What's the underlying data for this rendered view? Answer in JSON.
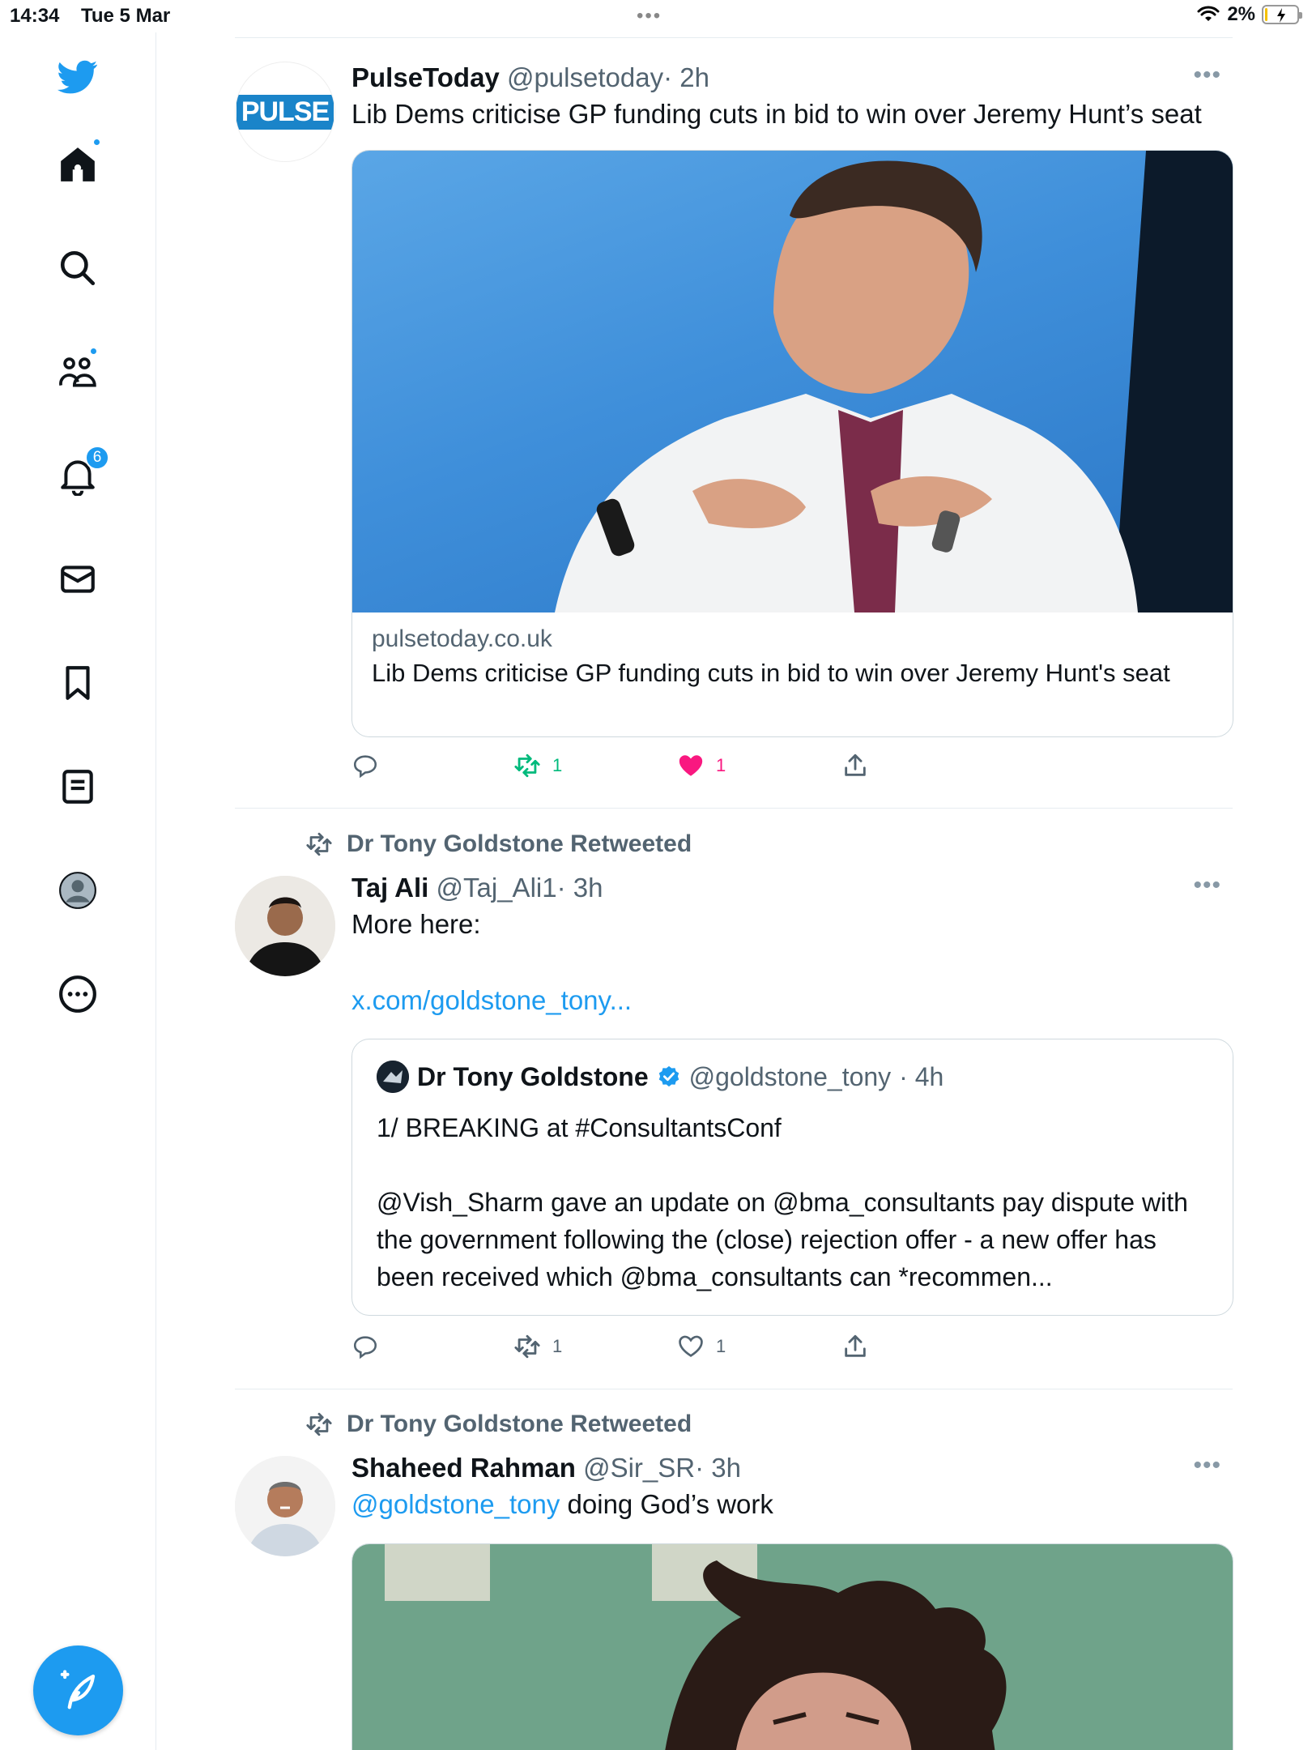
{
  "status_bar": {
    "time": "14:34",
    "date": "Tue 5 Mar",
    "battery": "2%",
    "battery_level": 0.02
  },
  "sidebar": {
    "items": [
      {
        "icon": "twitter-logo-icon"
      },
      {
        "icon": "home-icon"
      },
      {
        "icon": "search-icon"
      },
      {
        "icon": "communities-icon"
      },
      {
        "icon": "bell-icon",
        "badge": "6"
      },
      {
        "icon": "mail-icon"
      },
      {
        "icon": "bookmark-icon"
      },
      {
        "icon": "lists-icon"
      },
      {
        "icon": "profile-icon"
      },
      {
        "icon": "more-circle-icon"
      }
    ],
    "notification_badge": "6",
    "compose_icon": "compose-icon"
  },
  "accent": "#1d9bf0",
  "tweets": [
    {
      "name": "PulseToday",
      "handle": "@pulsetoday",
      "time": "· 2h",
      "avatar_text": "PULSE",
      "text": "Lib Dems criticise GP funding cuts in bid to win over Jeremy Hunt’s seat",
      "card": {
        "domain": "pulsetoday.co.uk",
        "title": "Lib Dems criticise GP funding cuts in bid to win over Jeremy Hunt's seat"
      },
      "retweets": "1",
      "likes": "1",
      "liked": true,
      "retweeted": true
    },
    {
      "retweeted_by": "Dr Tony Goldstone Retweeted",
      "name": "Taj Ali",
      "handle": "@Taj_Ali1",
      "time": "· 3h",
      "text": "More here:",
      "link": "x.com/goldstone_tony...",
      "quote": {
        "name": "Dr Tony Goldstone",
        "handle": "@goldstone_tony",
        "time": "· 4h",
        "text": "1/ BREAKING at #ConsultantsConf\n\n@Vish_Sharm gave an update on @bma_consultants pay dispute with the government following the (close) rejection offer - a new offer has been received which @bma_consultants can *recommen..."
      },
      "retweets": "1",
      "likes": "1"
    },
    {
      "retweeted_by": "Dr Tony Goldstone Retweeted",
      "name": "Shaheed Rahman",
      "handle": "@Sir_SR",
      "time": "· 3h",
      "mention": "@goldstone_tony",
      "text": " doing God’s work"
    }
  ]
}
